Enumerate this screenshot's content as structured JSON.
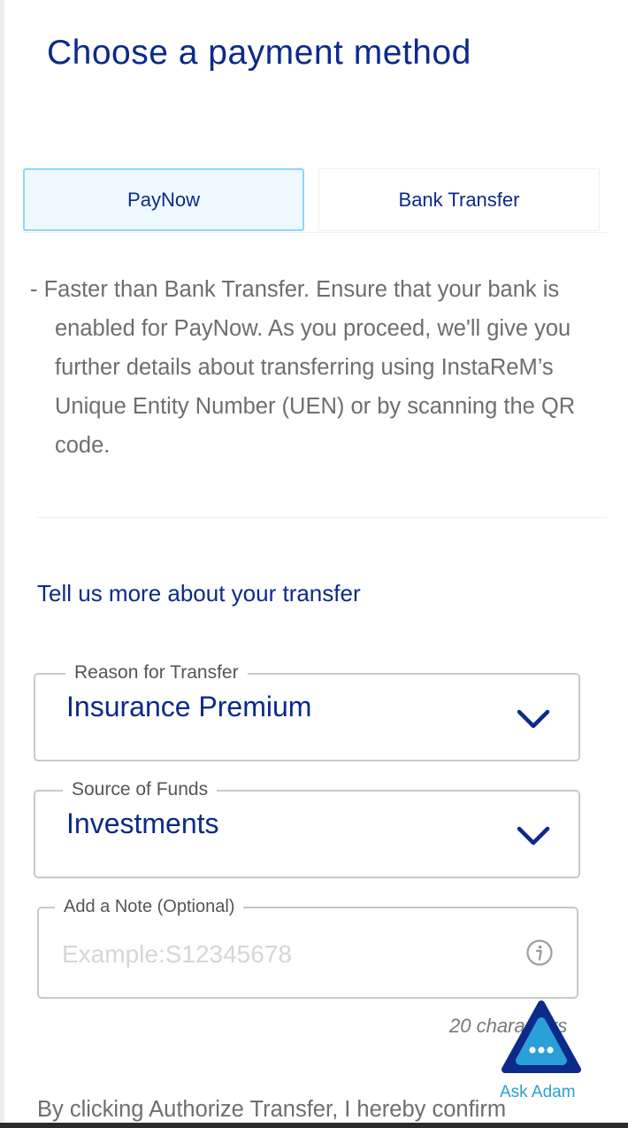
{
  "page": {
    "title": "Choose a payment method"
  },
  "tabs": [
    {
      "label": "PayNow",
      "selected": true
    },
    {
      "label": "Bank Transfer",
      "selected": false
    }
  ],
  "paynow": {
    "description": "- Faster than Bank Transfer. Ensure that your bank is enabled for PayNow. As you proceed, we'll give you further details about transferring using InstaReM’s Unique Entity Number (UEN) or by scanning the QR code."
  },
  "transfer_details": {
    "section_title": "Tell us more about your transfer",
    "reason": {
      "label": "Reason for Transfer",
      "value": "Insurance Premium"
    },
    "source": {
      "label": "Source of Funds",
      "value": "Investments"
    },
    "note": {
      "label": "Add a Note (Optional)",
      "placeholder": "Example:S12345678",
      "value": ""
    },
    "char_counter": "20 characters"
  },
  "chat_widget": {
    "label": "Ask Adam"
  },
  "consent": {
    "text": "By clicking Authorize Transfer, I hereby confirm"
  },
  "colors": {
    "primary": "#0b2a8a",
    "accent": "#2a9fd8",
    "selected_tab_bg": "#eef9ff",
    "selected_tab_border": "#8fd6f5",
    "body_text": "#6e6e6e"
  },
  "icons": {
    "dropdown": "chevron-down-icon",
    "info": "info-icon",
    "chat": "chat-bubble-icon"
  }
}
